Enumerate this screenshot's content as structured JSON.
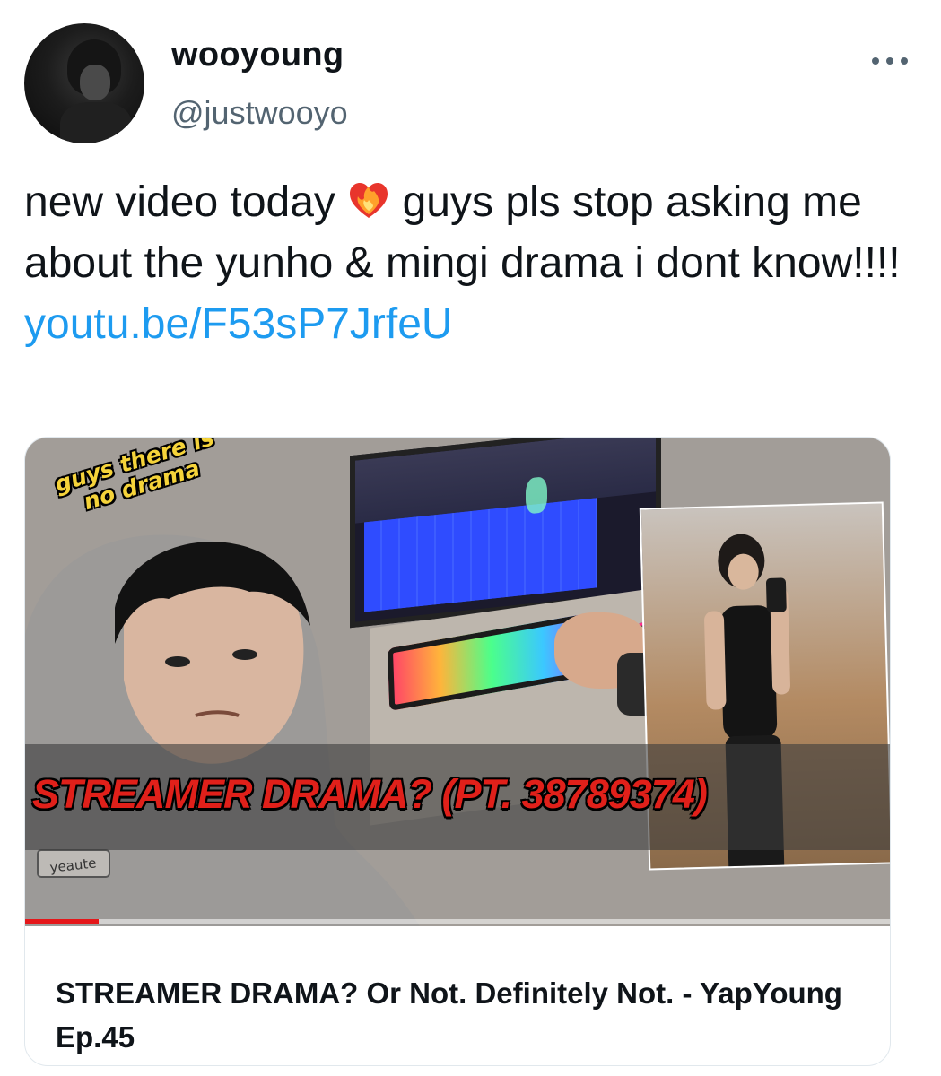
{
  "author": {
    "display_name": "wooyoung",
    "handle": "@justwooyo"
  },
  "tweet": {
    "text_before_emoji": "new video today",
    "emoji": "heart-on-fire",
    "text_after_emoji": " guys pls stop asking me about the yunho & mingi drama i dont know!!!! ",
    "link_text": "youtu.be/F53sP7JrfeU"
  },
  "link_card": {
    "thumbnail": {
      "sticker_text_line1": "guys there is",
      "sticker_text_line2": "no drama",
      "overlay_title": "STREAMER DRAMA? (PT. 38789374)",
      "hoodie_logo_text": "yeaute",
      "watch_progress": 0.085
    },
    "title": "STREAMER DRAMA? Or Not. Definitely Not. - YapYoung Ep.45"
  },
  "icons": {
    "more": "more-horizontal-icon",
    "emoji": "heart-on-fire-icon"
  },
  "colors": {
    "link": "#1d9bf0",
    "text": "#0f1419",
    "secondary_text": "#536471",
    "progress": "#e5171a",
    "overlay_title": "#e0201a",
    "sticker": "#f5d33a"
  }
}
